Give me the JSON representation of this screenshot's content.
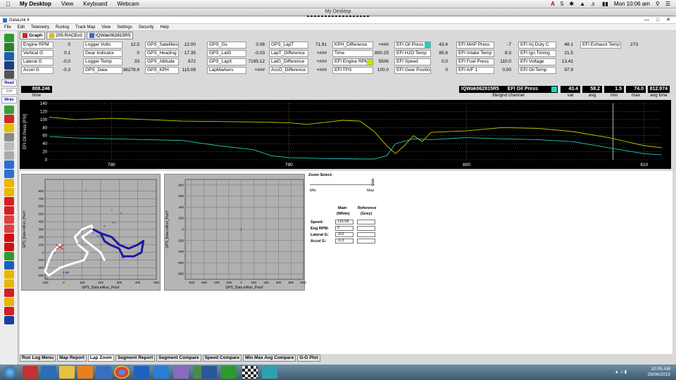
{
  "macbar": {
    "menus": [
      "My Desktop",
      "View",
      "Keyboard",
      "Webcam"
    ],
    "status_right": [
      "5",
      "Mon 10:06 am"
    ]
  },
  "window_title": "My Desktop",
  "app_title": "DataLink II",
  "menubar": [
    "File",
    "Edit",
    "Telemetry",
    "Runlog",
    "Track Map",
    "View",
    "Settings",
    "Security",
    "Help"
  ],
  "left_toolbar_text": [
    "Read",
    "Diff",
    "Write"
  ],
  "tabs": [
    {
      "label": "Graph",
      "active": true
    },
    {
      "label": "205 RACEv2",
      "active": false
    },
    {
      "label": "IQWak062815R5",
      "active": false
    }
  ],
  "channels": [
    [
      {
        "label": "Engine RPM",
        "value": "0"
      },
      {
        "label": "Vertical G",
        "value": "0.1"
      },
      {
        "label": "Lateral G",
        "value": "-0.0"
      },
      {
        "label": "Accel G",
        "value": "-0.3"
      }
    ],
    [
      {
        "label": "Logger Volts",
        "value": "12.5"
      },
      {
        "label": "Gear Indicator",
        "value": "0"
      },
      {
        "label": "Logger Temp",
        "value": "33"
      },
      {
        "label": "GPS_Data",
        "value": "36278.8"
      }
    ],
    [
      {
        "label": "GPS_Satellites",
        "value": "12.00"
      },
      {
        "label": "GPS_Heading",
        "value": "17.35"
      },
      {
        "label": "GPS_Altitude",
        "value": "672"
      },
      {
        "label": "GPS_KPH",
        "value": "115.08"
      }
    ],
    [
      {
        "label": "GPS_Gs",
        "value": "0.08"
      },
      {
        "label": "GPS_LatG",
        "value": "-0.03"
      },
      {
        "label": "GPS_LapX",
        "value": "7195.12"
      },
      {
        "label": "LapMarkers",
        "value": "+###"
      }
    ],
    [
      {
        "label": "GPS_LapT",
        "value": "71.91"
      },
      {
        "label": "LapT_Difference",
        "value": "+###"
      },
      {
        "label": "LatG_Difference",
        "value": "+###"
      },
      {
        "label": "AccG_Difference",
        "value": "+###"
      }
    ],
    [
      {
        "label": "KPH_Difference",
        "value": "+###"
      },
      {
        "label": "Time",
        "value": "800.25"
      },
      {
        "label": "EFI Engine RPM",
        "value": "5506",
        "swatch": "#c8e600"
      },
      {
        "label": "EFI TPS",
        "value": "100.0"
      }
    ],
    [
      {
        "label": "EFI Oil Press",
        "value": "43.4",
        "swatch": "#22d0b8"
      },
      {
        "label": "EFI H2O Temp",
        "value": "85.6"
      },
      {
        "label": "EFI Speed",
        "value": "0.0"
      },
      {
        "label": "EFI Gear Position",
        "value": "0"
      }
    ],
    [
      {
        "label": "EFI MAP Press",
        "value": "-7"
      },
      {
        "label": "EFI Intake Temp",
        "value": "8.3"
      },
      {
        "label": "EFI Fuel Press",
        "value": "110.0"
      },
      {
        "label": "EFI A/F 1",
        "value": "0.00"
      }
    ],
    [
      {
        "label": "EFI Inj Duty C",
        "value": "48.1"
      },
      {
        "label": "EFI Ign Timing",
        "value": "21.5"
      },
      {
        "label": "EFI Voltage",
        "value": "13.41"
      },
      {
        "label": "EFI Oil Temp",
        "value": "97.9"
      }
    ],
    [
      {
        "label": "EFI Exhaust Temp",
        "value": "273"
      }
    ]
  ],
  "cursor": {
    "time_value": "808.246",
    "time_caption": "time",
    "file_label": "IQWak062815R5",
    "channel_label": "EFI Oil Press",
    "file_caption": "file/gnd channel",
    "stats": [
      {
        "value": "43.4",
        "caption": "val"
      },
      {
        "value": "58.2",
        "caption": "avg"
      },
      {
        "value": "1.5",
        "caption": "min"
      },
      {
        "value": "74.0",
        "caption": "max"
      },
      {
        "value": "812.974",
        "caption": "avg time"
      }
    ]
  },
  "chart_data": [
    {
      "type": "line",
      "ylabel": "EFI Oil Press [PSI]",
      "ylim": [
        0,
        140
      ],
      "yticks": [
        0,
        20,
        40,
        60,
        80,
        100,
        120,
        140
      ],
      "xlim": [
        776.5,
        811
      ],
      "xticks": [
        780,
        790,
        800,
        810
      ],
      "grid": true,
      "series": [
        {
          "color": "#c8c800",
          "x": [
            776.5,
            778,
            780,
            782,
            784,
            786,
            788,
            790,
            791,
            792,
            793,
            794,
            794.8,
            795.5,
            796,
            796.5,
            797,
            797.5,
            798,
            800,
            802,
            804,
            806,
            808,
            810,
            811
          ],
          "y": [
            106,
            100,
            103,
            100,
            96,
            95,
            94,
            92,
            88,
            93,
            98,
            96,
            70,
            35,
            15,
            35,
            60,
            45,
            68,
            72,
            80,
            78,
            70,
            55,
            35,
            30
          ]
        },
        {
          "color": "#22c9b4",
          "x": [
            776.5,
            778,
            780,
            782,
            784,
            786,
            788,
            789,
            790,
            792,
            794,
            794.8,
            795.5,
            796,
            797,
            798,
            800,
            802,
            804,
            806,
            808,
            810,
            811
          ],
          "y": [
            58,
            54,
            52,
            50,
            48,
            35,
            25,
            10,
            5,
            3,
            2,
            2,
            10,
            40,
            52,
            50,
            55,
            52,
            50,
            45,
            30,
            15,
            12
          ]
        }
      ]
    },
    {
      "type": "line",
      "xlabel": "GPS_Data.mRun_PosX",
      "ylabel": "GPS_Data.mRun_PosY",
      "xlim": [
        -100,
        500
      ],
      "ylim": [
        -350,
        950
      ],
      "xticks": [
        -100,
        0,
        100,
        200,
        300,
        400,
        500
      ],
      "yticks": [
        -300,
        -200,
        -100,
        0,
        100,
        200,
        300,
        400,
        500,
        600,
        700,
        800
      ],
      "annotations": [
        "1",
        "2",
        "3",
        "4",
        "5",
        "6",
        "7",
        "8",
        "9",
        "10",
        "11",
        "6-7",
        "5-6",
        "3-4",
        "9-10"
      ],
      "series": [
        {
          "color": "#ffffff",
          "x": [
            -20,
            -60,
            -80,
            -100,
            -80,
            -20,
            40,
            110,
            130,
            80,
            60,
            100,
            150,
            160,
            130,
            100,
            120,
            200,
            220
          ],
          "y": [
            100,
            0,
            -100,
            -250,
            -300,
            -200,
            -150,
            -100,
            0,
            100,
            200,
            300,
            350,
            300,
            250,
            200,
            150,
            0,
            -100
          ]
        },
        {
          "color": "#1a1aa0",
          "x": [
            160,
            200,
            260,
            300,
            350,
            400,
            430,
            420,
            380,
            320,
            300,
            250,
            220,
            200,
            160
          ],
          "y": [
            300,
            250,
            200,
            100,
            50,
            100,
            150,
            0,
            -50,
            -50,
            50,
            100,
            150,
            250,
            300
          ]
        }
      ]
    },
    {
      "type": "scatter",
      "xlabel": "GPS_Data.mRun_PosX",
      "ylabel": "GPS_Data.mRun_PosY",
      "xlim": [
        -900,
        1000
      ],
      "ylim": [
        -900,
        900
      ],
      "xticks": [
        -800,
        -600,
        -400,
        -200,
        0,
        200,
        400,
        600,
        800,
        1000
      ],
      "yticks": [
        -800,
        -600,
        -400,
        -200,
        0,
        200,
        400,
        600,
        800
      ]
    }
  ],
  "zoom": {
    "label": "Zoom Select:",
    "min": "Min",
    "max": "Max",
    "col_main": "Main",
    "col_main_sub": "(White)",
    "col_ref": "Reference",
    "col_ref_sub": "(Grey)",
    "rows": [
      {
        "label": "Speed:",
        "main": "115.08",
        "ref": ""
      },
      {
        "label": "Eng RPM:",
        "main": "0",
        "ref": ""
      },
      {
        "label": "Lateral G:",
        "main": "-0.0",
        "ref": ""
      },
      {
        "label": "Accel G:",
        "main": "-0.3",
        "ref": ""
      }
    ]
  },
  "bottom_tabs": [
    {
      "label": "Run Log Menu",
      "active": false
    },
    {
      "label": "Map Report",
      "active": false
    },
    {
      "label": "Lap Zoom",
      "active": true
    },
    {
      "label": "Segment Report",
      "active": false
    },
    {
      "label": "Segment Compare",
      "active": false
    },
    {
      "label": "Speed Compare",
      "active": false
    },
    {
      "label": "Min Max Avg Compare",
      "active": false
    },
    {
      "label": "G-G Plot",
      "active": false
    }
  ],
  "taskbar": {
    "time": "10:05 AM",
    "date": "29/06/2015"
  }
}
